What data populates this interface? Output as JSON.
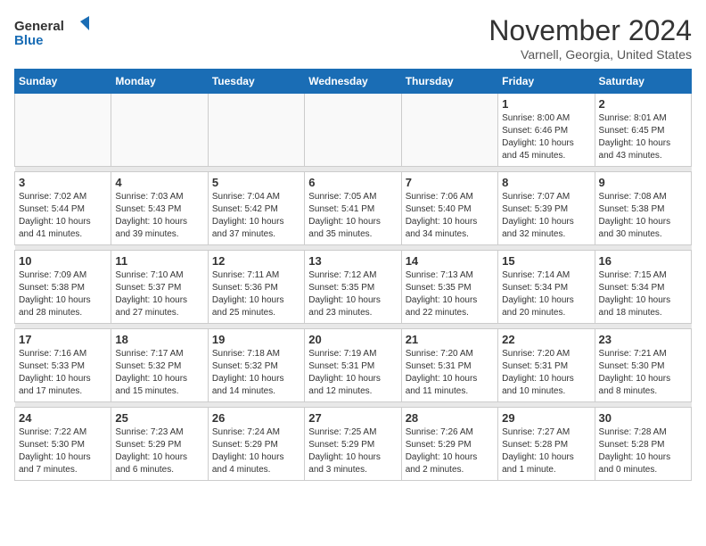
{
  "logo": {
    "line1": "General",
    "line2": "Blue"
  },
  "title": "November 2024",
  "location": "Varnell, Georgia, United States",
  "weekdays": [
    "Sunday",
    "Monday",
    "Tuesday",
    "Wednesday",
    "Thursday",
    "Friday",
    "Saturday"
  ],
  "weeks": [
    [
      {
        "day": "",
        "detail": ""
      },
      {
        "day": "",
        "detail": ""
      },
      {
        "day": "",
        "detail": ""
      },
      {
        "day": "",
        "detail": ""
      },
      {
        "day": "",
        "detail": ""
      },
      {
        "day": "1",
        "detail": "Sunrise: 8:00 AM\nSunset: 6:46 PM\nDaylight: 10 hours\nand 45 minutes."
      },
      {
        "day": "2",
        "detail": "Sunrise: 8:01 AM\nSunset: 6:45 PM\nDaylight: 10 hours\nand 43 minutes."
      }
    ],
    [
      {
        "day": "3",
        "detail": "Sunrise: 7:02 AM\nSunset: 5:44 PM\nDaylight: 10 hours\nand 41 minutes."
      },
      {
        "day": "4",
        "detail": "Sunrise: 7:03 AM\nSunset: 5:43 PM\nDaylight: 10 hours\nand 39 minutes."
      },
      {
        "day": "5",
        "detail": "Sunrise: 7:04 AM\nSunset: 5:42 PM\nDaylight: 10 hours\nand 37 minutes."
      },
      {
        "day": "6",
        "detail": "Sunrise: 7:05 AM\nSunset: 5:41 PM\nDaylight: 10 hours\nand 35 minutes."
      },
      {
        "day": "7",
        "detail": "Sunrise: 7:06 AM\nSunset: 5:40 PM\nDaylight: 10 hours\nand 34 minutes."
      },
      {
        "day": "8",
        "detail": "Sunrise: 7:07 AM\nSunset: 5:39 PM\nDaylight: 10 hours\nand 32 minutes."
      },
      {
        "day": "9",
        "detail": "Sunrise: 7:08 AM\nSunset: 5:38 PM\nDaylight: 10 hours\nand 30 minutes."
      }
    ],
    [
      {
        "day": "10",
        "detail": "Sunrise: 7:09 AM\nSunset: 5:38 PM\nDaylight: 10 hours\nand 28 minutes."
      },
      {
        "day": "11",
        "detail": "Sunrise: 7:10 AM\nSunset: 5:37 PM\nDaylight: 10 hours\nand 27 minutes."
      },
      {
        "day": "12",
        "detail": "Sunrise: 7:11 AM\nSunset: 5:36 PM\nDaylight: 10 hours\nand 25 minutes."
      },
      {
        "day": "13",
        "detail": "Sunrise: 7:12 AM\nSunset: 5:35 PM\nDaylight: 10 hours\nand 23 minutes."
      },
      {
        "day": "14",
        "detail": "Sunrise: 7:13 AM\nSunset: 5:35 PM\nDaylight: 10 hours\nand 22 minutes."
      },
      {
        "day": "15",
        "detail": "Sunrise: 7:14 AM\nSunset: 5:34 PM\nDaylight: 10 hours\nand 20 minutes."
      },
      {
        "day": "16",
        "detail": "Sunrise: 7:15 AM\nSunset: 5:34 PM\nDaylight: 10 hours\nand 18 minutes."
      }
    ],
    [
      {
        "day": "17",
        "detail": "Sunrise: 7:16 AM\nSunset: 5:33 PM\nDaylight: 10 hours\nand 17 minutes."
      },
      {
        "day": "18",
        "detail": "Sunrise: 7:17 AM\nSunset: 5:32 PM\nDaylight: 10 hours\nand 15 minutes."
      },
      {
        "day": "19",
        "detail": "Sunrise: 7:18 AM\nSunset: 5:32 PM\nDaylight: 10 hours\nand 14 minutes."
      },
      {
        "day": "20",
        "detail": "Sunrise: 7:19 AM\nSunset: 5:31 PM\nDaylight: 10 hours\nand 12 minutes."
      },
      {
        "day": "21",
        "detail": "Sunrise: 7:20 AM\nSunset: 5:31 PM\nDaylight: 10 hours\nand 11 minutes."
      },
      {
        "day": "22",
        "detail": "Sunrise: 7:20 AM\nSunset: 5:31 PM\nDaylight: 10 hours\nand 10 minutes."
      },
      {
        "day": "23",
        "detail": "Sunrise: 7:21 AM\nSunset: 5:30 PM\nDaylight: 10 hours\nand 8 minutes."
      }
    ],
    [
      {
        "day": "24",
        "detail": "Sunrise: 7:22 AM\nSunset: 5:30 PM\nDaylight: 10 hours\nand 7 minutes."
      },
      {
        "day": "25",
        "detail": "Sunrise: 7:23 AM\nSunset: 5:29 PM\nDaylight: 10 hours\nand 6 minutes."
      },
      {
        "day": "26",
        "detail": "Sunrise: 7:24 AM\nSunset: 5:29 PM\nDaylight: 10 hours\nand 4 minutes."
      },
      {
        "day": "27",
        "detail": "Sunrise: 7:25 AM\nSunset: 5:29 PM\nDaylight: 10 hours\nand 3 minutes."
      },
      {
        "day": "28",
        "detail": "Sunrise: 7:26 AM\nSunset: 5:29 PM\nDaylight: 10 hours\nand 2 minutes."
      },
      {
        "day": "29",
        "detail": "Sunrise: 7:27 AM\nSunset: 5:28 PM\nDaylight: 10 hours\nand 1 minute."
      },
      {
        "day": "30",
        "detail": "Sunrise: 7:28 AM\nSunset: 5:28 PM\nDaylight: 10 hours\nand 0 minutes."
      }
    ]
  ]
}
